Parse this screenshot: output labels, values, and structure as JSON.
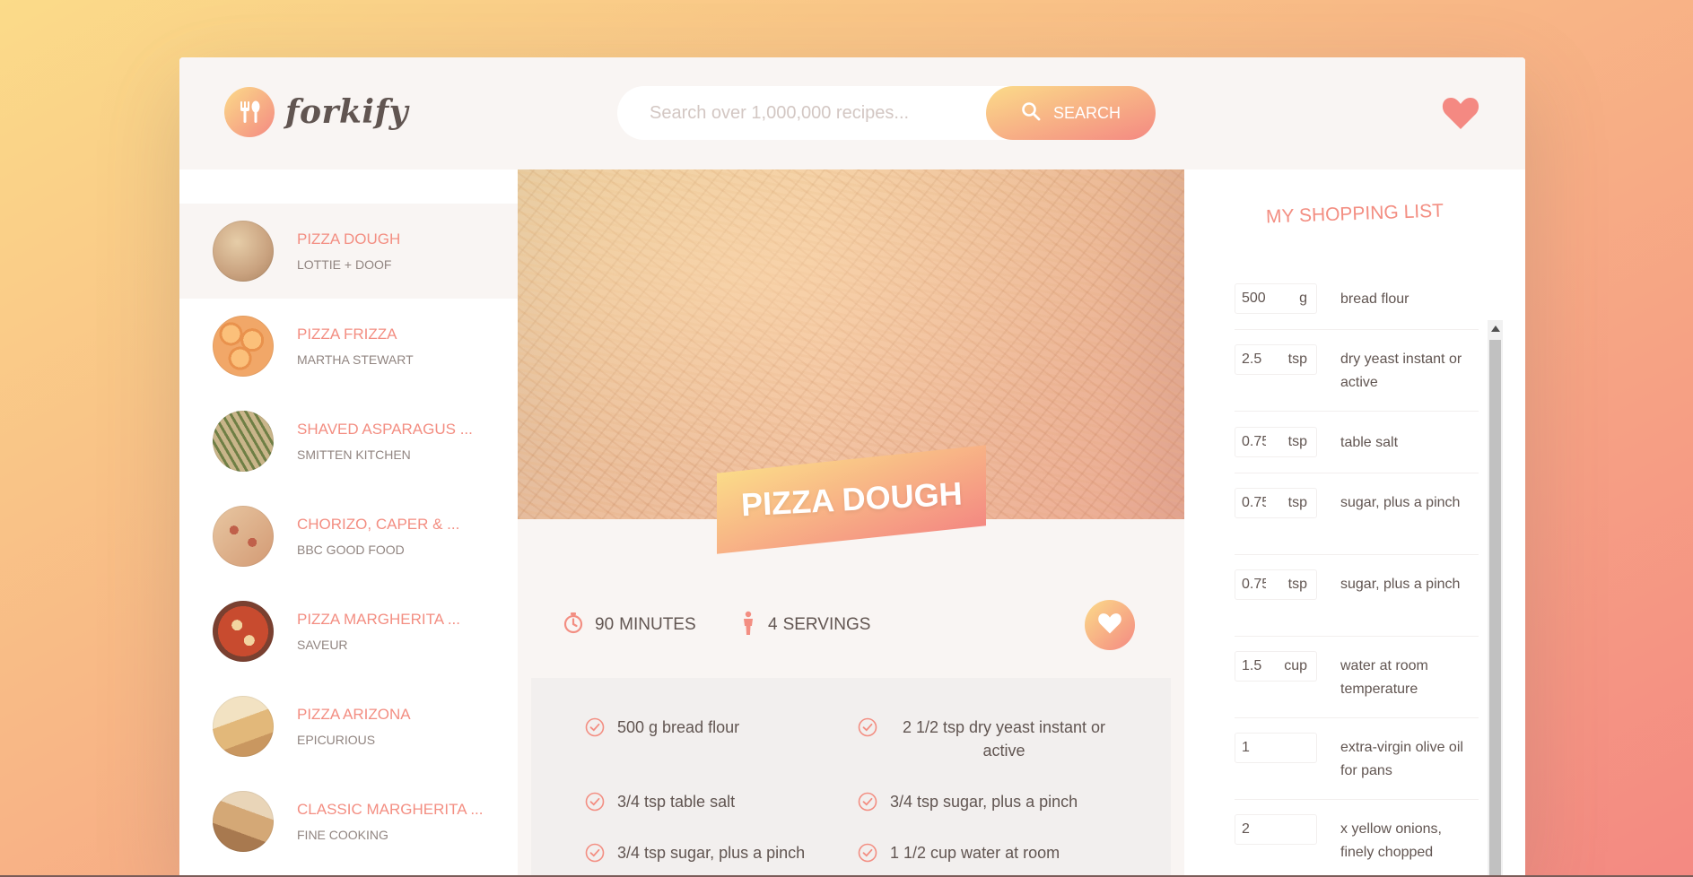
{
  "app": {
    "name": "forkify"
  },
  "search": {
    "placeholder": "Search over 1,000,000 recipes...",
    "button_label": "SEARCH"
  },
  "results": [
    {
      "title": "PIZZA DOUGH",
      "publisher": "LOTTIE + DOOF",
      "active": true,
      "thumb": "#c9a27f"
    },
    {
      "title": "PIZZA FRIZZA",
      "publisher": "MARTHA STEWART",
      "active": false,
      "thumb": "#f0a05a"
    },
    {
      "title": "SHAVED ASPARAGUS ...",
      "publisher": "SMITTEN KITCHEN",
      "active": false,
      "thumb": "#8f9a5f"
    },
    {
      "title": "CHORIZO, CAPER & ...",
      "publisher": "BBC GOOD FOOD",
      "active": false,
      "thumb": "#d9a47e"
    },
    {
      "title": "PIZZA MARGHERITA ...",
      "publisher": "SAVEUR",
      "active": false,
      "thumb": "#a8533a"
    },
    {
      "title": "PIZZA ARIZONA",
      "publisher": "EPICURIOUS",
      "active": false,
      "thumb": "#e2c48e"
    },
    {
      "title": "CLASSIC MARGHERITA ...",
      "publisher": "FINE COOKING",
      "active": false,
      "thumb": "#b98a62"
    }
  ],
  "recipe": {
    "title": "PIZZA DOUGH",
    "time_value": "90",
    "time_label": "MINUTES",
    "servings_value": "4",
    "servings_label": "SERVINGS",
    "ingredients": [
      "500 g bread flour",
      "2 1/2 tsp dry yeast instant or active",
      "3/4 tsp table salt",
      "3/4 tsp sugar, plus a pinch",
      "3/4 tsp sugar, plus a pinch",
      "1 1/2 cup water at room"
    ]
  },
  "shopping": {
    "title": "MY SHOPPING LIST",
    "items": [
      {
        "count": "500",
        "unit": "g",
        "name": "bread flour"
      },
      {
        "count": "2.5",
        "unit": "tsp",
        "name": "dry yeast instant or active"
      },
      {
        "count": "0.75",
        "unit": "tsp",
        "name": "table salt"
      },
      {
        "count": "0.75",
        "unit": "tsp",
        "name": "sugar, plus a pinch"
      },
      {
        "count": "0.75",
        "unit": "tsp",
        "name": "sugar, plus a pinch"
      },
      {
        "count": "1.5",
        "unit": "cup",
        "name": "water at room temperature"
      },
      {
        "count": "1",
        "unit": "",
        "name": "extra-virgin olive oil for pans"
      },
      {
        "count": "2",
        "unit": "",
        "name": "x yellow onions, finely chopped"
      }
    ]
  },
  "icons": {
    "logo": "fork-spoon-icon",
    "search": "search-icon",
    "likes": "heart-icon",
    "time": "stopwatch-icon",
    "servings": "person-icon",
    "check": "check-circle-icon"
  },
  "colors": {
    "accent_start": "#fbdb89",
    "accent_end": "#f48982",
    "text": "#615551",
    "link": "#f38e82"
  }
}
